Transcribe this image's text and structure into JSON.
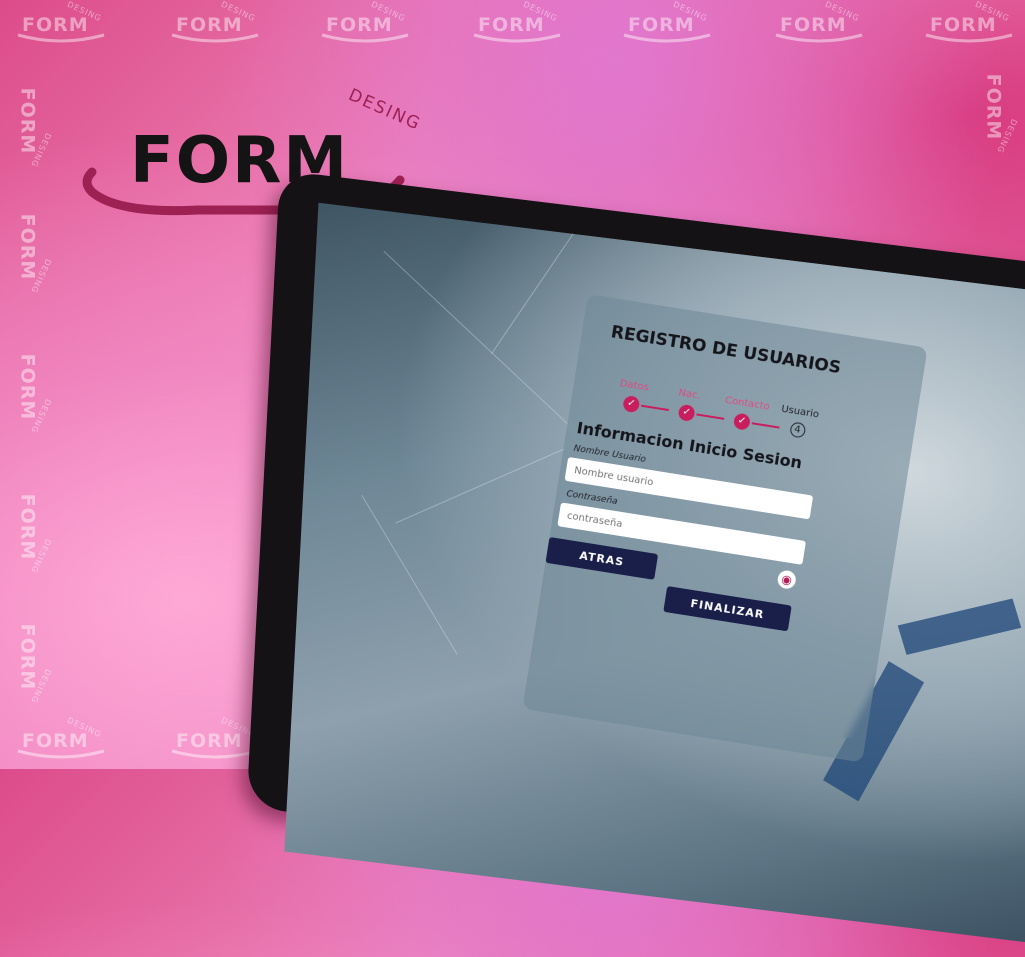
{
  "watermark": {
    "word": "FORM",
    "sub": "DESING"
  },
  "logo": {
    "word": "FORM",
    "sub": "DESING"
  },
  "form": {
    "title": "REGISTRO DE USUARIOS",
    "steps": [
      {
        "label": "Datos",
        "marker": "✓"
      },
      {
        "label": "Nac.",
        "marker": "✓"
      },
      {
        "label": "Contacto",
        "marker": "✓"
      },
      {
        "label": "Usuario",
        "marker": "4"
      }
    ],
    "section_title": "Informacion Inicio Sesion",
    "username": {
      "label": "Nombre Usuario",
      "placeholder": "Nombre usuario"
    },
    "password": {
      "label": "Contraseña",
      "placeholder": "contraseña"
    },
    "back_button": "ATRAS",
    "finish_button": "FINALIZAR"
  },
  "colors": {
    "accent": "#c81e5e",
    "button": "#1a1f4a",
    "logo_curve": "#9e2154"
  }
}
